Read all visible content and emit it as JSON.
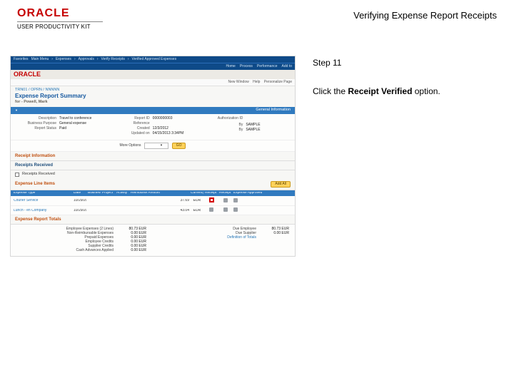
{
  "doc": {
    "logo_text": "ORACLE",
    "upk": "USER PRODUCTIVITY KIT",
    "title": "Verifying Expense Report Receipts",
    "step": "Step 11",
    "instr_pre": "Click the ",
    "instr_bold": "Receipt Verified",
    "instr_post": " option."
  },
  "app": {
    "brand": "ORACLE",
    "topmenu": [
      "Favorites",
      "Main Menu",
      "Expenses",
      "Approvals",
      "Verify Receipts",
      "Verified Approved Expenses"
    ],
    "subnav": [
      "Home",
      "Process",
      "Performance",
      "Add to"
    ],
    "userbar": {
      "u1": "New Window",
      "u2": "Help",
      "u3": "Personalize Page"
    },
    "breadcrumb": "TRN01 / OPRN / NNNNN",
    "page_title": "Expense Report Summary",
    "for_line": "for - Powell, Mark",
    "band_general": "General Information",
    "info": {
      "desc_lbl": "Description",
      "desc_val": "Travel to conference",
      "bu_lbl": "Business Purpose",
      "bu_val": "General expense",
      "status_lbl": "Report Status",
      "status_val": "Paid",
      "rpt_lbl": "Report ID",
      "rpt_val": "0000000003",
      "ref_lbl": "Reference",
      "cre_lbl": "Created",
      "cre_val": "12/3/2012",
      "upd_lbl": "Updated on",
      "upd_val": "04/15/2013   3:34PM",
      "auth_lbl": "Authorization ID",
      "by_lbl": "By",
      "by_val": "SAMPLE",
      "by2_lbl": "By",
      "by2_val": "SAMPLE"
    },
    "more_label": "More Options",
    "more_go": "GO",
    "sec_receipt_info": "Receipt Information",
    "sec_receipts_recv": "Receipts Received",
    "chk_receipts_recv": "Receipts Received",
    "sec_expense_lines": "Expense Line Items",
    "add_all_btn": "Add    All",
    "th": {
      "c1": "Expense Type",
      "c2": "Date",
      "c3": "Business",
      "c4": "Project",
      "c5": "Activity",
      "c6": "Reimburse Amount",
      "c7": "Currency",
      "c8": "Receipt Verified",
      "c9": "Receipt Received",
      "c10": "Expense Approved"
    },
    "rows": [
      {
        "type": "Courier Service",
        "date": "10/29/2012",
        "amt": "37.69",
        "cur": "EUR"
      },
      {
        "type": "Lunch - en Company",
        "date": "10/29/2012",
        "amt": "43.04",
        "cur": "EUR"
      }
    ],
    "sec_totals": "Expense Report Totals",
    "totals": {
      "l1_lbl": "Employee Expenses (2 Lines)",
      "l1_val": "80.73  EUR",
      "l2_lbl": "Non-Reimbursable Expenses",
      "l2_val": "0.00  EUR",
      "l3_lbl": "Prepaid Expenses",
      "l3_val": "0.00  EUR",
      "l4_lbl": "Employee Credits",
      "l4_val": "0.00  EUR",
      "l5_lbl": "Supplier Credits",
      "l5_val": "0.00  EUR",
      "l6_lbl": "Cash Advances Applied",
      "l6_val": "0.00  EUR",
      "r1_lbl": "Due Employee",
      "r1_val": "80.73  EUR",
      "r2_lbl": "Due Supplier",
      "r2_val": "0.00  EUR",
      "r3_lbl": "Definition of Totals"
    }
  }
}
